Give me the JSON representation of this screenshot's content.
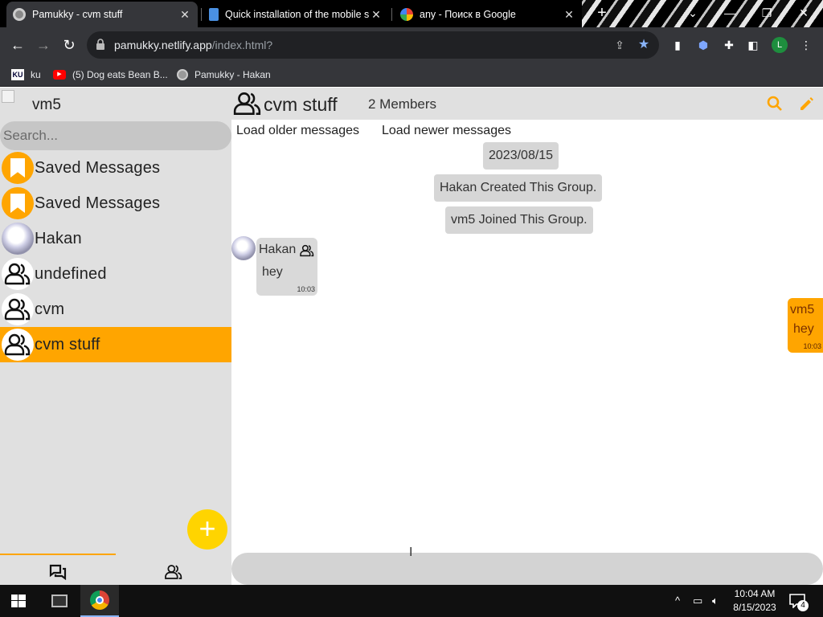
{
  "browser": {
    "tabs": [
      {
        "title": "Pamukky - cvm stuff",
        "active": true
      },
      {
        "title": "Quick installation of the mobile s",
        "active": false
      },
      {
        "title": "any - Поиск в Google",
        "active": false
      }
    ],
    "url_host": "pamukky.netlify.app",
    "url_path": "/index.html?",
    "profile_initial": "L",
    "bookmarks": [
      {
        "label": "ku",
        "icon": "ku-favicon"
      },
      {
        "label": "(5) Dog eats Bean B...",
        "icon": "youtube-icon"
      },
      {
        "label": "Pamukky - Hakan",
        "icon": "globe-icon"
      }
    ]
  },
  "sidebar": {
    "user_name": "vm5",
    "search_placeholder": "Search...",
    "chats": [
      {
        "name": "Saved Messages",
        "avatar": "bookmark-icon"
      },
      {
        "name": "Saved Messages",
        "avatar": "bookmark-icon"
      },
      {
        "name": "Hakan",
        "avatar": "user-photo"
      },
      {
        "name": "undefined",
        "avatar": "group-icon"
      },
      {
        "name": "cvm",
        "avatar": "group-icon"
      },
      {
        "name": "cvm stuff",
        "avatar": "group-icon",
        "active": true
      }
    ],
    "fab_label": "+"
  },
  "chat": {
    "title": "cvm stuff",
    "members": "2 Members",
    "load_older": "Load older messages",
    "load_newer": "Load newer messages",
    "date": "2023/08/15",
    "system_messages": [
      "Hakan Created This Group.",
      "vm5 Joined This Group."
    ],
    "messages": [
      {
        "sender": "Hakan",
        "text": "hey",
        "time": "10:03",
        "direction": "incoming"
      },
      {
        "sender": "vm5",
        "text": "hey",
        "time": "10:03",
        "direction": "outgoing"
      }
    ],
    "composer_value": ""
  },
  "taskbar": {
    "time": "10:04 AM",
    "date": "8/15/2023",
    "notifications": "4"
  },
  "colors": {
    "accent": "#ffa500",
    "fab": "#ffd400",
    "sidebar_bg": "#e0e0e0",
    "browser_chrome": "#35363a"
  }
}
